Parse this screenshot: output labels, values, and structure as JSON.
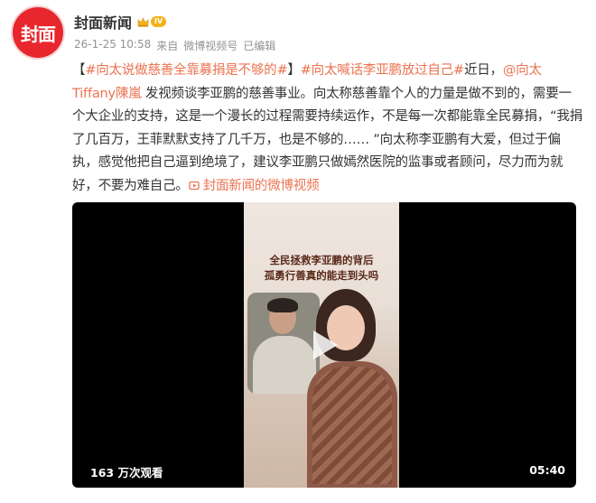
{
  "author": {
    "avatar_text": "封面",
    "name": "封面新闻",
    "badge_level": "IV"
  },
  "meta": {
    "timestamp": "26-1-25 10:58",
    "source_prefix": "来自",
    "source": "微博视频号",
    "edited": "已编辑"
  },
  "post": {
    "bracket_open": "【",
    "tag1": "#向太说做慈善全靠募捐是不够的#",
    "bracket_close": "】",
    "tag2": "#向太喊话李亚鹏放过自己#",
    "text1": "近日，",
    "mention": "@向太Tiffany陳嵐",
    "text2": " 发视频谈李亚鹏的慈善事业。向太称慈善靠个人的力量是做不到的，需要一个大企业的支持，这是一个漫长的过程需要持续运作，不是每一次都能靠全民募捐，“我捐了几百万，王菲默默支持了几千万，也是不够的…… ”向太称李亚鹏有大爱，但过于偏执，感觉他把自己逼到绝境了，建议李亚鹏只做嫣然医院的监事或者顾问，尽力而为就好，不要为难自己。",
    "link_text": "封面新闻的微博视频"
  },
  "video": {
    "poster_line1": "全民拯救李亚鹏的背后",
    "poster_line2": "孤勇行善真的能走到头吗",
    "views": "163 万次观看",
    "duration": "05:40"
  },
  "colors": {
    "accent": "#eb7350",
    "avatar_bg": "#e8262d",
    "meta_gray": "#939393",
    "badge_gold": "#f2b21c"
  },
  "icons": {
    "avatar": "fengmian-logo",
    "badge": "crown-icon",
    "link": "video-link-icon",
    "play": "play-icon"
  }
}
